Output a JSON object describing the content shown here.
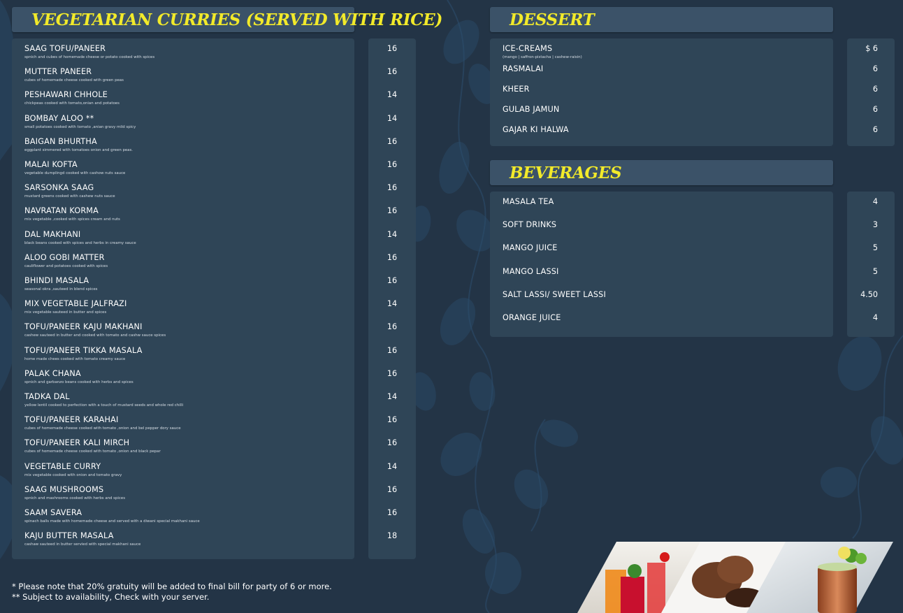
{
  "curries": {
    "title": "VEGETARIAN  CURRIES (SERVED WITH RICE)",
    "items": [
      {
        "name": "SAAG TOFU/PANEER",
        "desc": "spnich and cubes of homemade cheese or potato cooked with spices",
        "price": "16"
      },
      {
        "name": "MUTTER PANEER",
        "desc": "cubes of homemade cheese cooked with green peas",
        "price": "16"
      },
      {
        "name": "PESHAWARI CHHOLE",
        "desc": "chickpeas cooked with tomato,onian and potatoes",
        "price": "14"
      },
      {
        "name": "BOMBAY ALOO **",
        "desc": "small potatoes cooked with tomato ,anian gravy mild spicy",
        "price": "14"
      },
      {
        "name": "BAIGAN BHURTHA",
        "desc": "eggplant simmered with tomatoes  onion and green peas.",
        "price": "16"
      },
      {
        "name": "MALAI KOFTA",
        "desc": "vegetable dumplingd cooked with cashow nuts sauce",
        "price": "16"
      },
      {
        "name": "SARSONKA SAAG",
        "desc": "mustard greens cooked with cashew nuts sauce",
        "price": "16"
      },
      {
        "name": "NAVRATAN KORMA",
        "desc": "mix vegetable ,cooked with spices cream and nuts",
        "price": "16"
      },
      {
        "name": "DAL MAKHANI",
        "desc": "black beans cooked with spices and herbs in creamy sauce",
        "price": "14"
      },
      {
        "name": "ALOO GOBI MATTER",
        "desc": "cauliflower and potatoes cooked with spices",
        "price": "16"
      },
      {
        "name": "BHINDI MASALA",
        "desc": "seasonal okra ,sauteed in blend spices",
        "price": "16"
      },
      {
        "name": "MIX VEGETABLE JALFRAZI",
        "desc": "mix vegetable sauteed in butter and spices",
        "price": "14"
      },
      {
        "name": "TOFU/PANEER KAJU MAKHANI",
        "desc": "cashew sauteed in butter and cooked with tomato and cashw sauce spices",
        "price": "16"
      },
      {
        "name": "TOFU/PANEER TIKKA MASALA",
        "desc": "home made  chees cooked with tomato creamy sauce",
        "price": "16"
      },
      {
        "name": "PALAK CHANA",
        "desc": "spnich and garbanzo beans cooked with herbs and spices",
        "price": "16"
      },
      {
        "name": "TADKA DAL",
        "desc": "yellow lentil cooked to perfection with a touch of mustard seeds and whole red chilli",
        "price": "14"
      },
      {
        "name": "TOFU/PANEER KARAHAI",
        "desc": "cubes of homemade cheese cooked with tomato ,onion and bel pepper dory sauce",
        "price": "16"
      },
      {
        "name": "TOFU/PANEER KALI MIRCH",
        "desc": "cubes of homemade cheese cooked with tomato ,onion and black pepar",
        "price": "16"
      },
      {
        "name": "VEGETABLE CURRY",
        "desc": "mix vegetable cooked with onion and tomato gravy",
        "price": "14"
      },
      {
        "name": "SAAG MUSHROOMS",
        "desc": "spnich and mashrooms cooked with herbs and spices",
        "price": "16"
      },
      {
        "name": "SAAM SAVERA",
        "desc": "spinach balls made with homemade cheese and served with a diwani special makhani sauce",
        "price": "16"
      },
      {
        "name": "KAJU BUTTER MASALA",
        "desc": "cashaw sauteed in butter servied with  special makhani sauce",
        "price": "18"
      }
    ]
  },
  "dessert": {
    "title": "DESSERT",
    "items": [
      {
        "name": "ICE-CREAMS",
        "desc": "(mango  |  saffron-pistacha  |  cashew-raisin)",
        "price": "$ 6"
      },
      {
        "name": "RASMALAI",
        "desc": "",
        "price": "6"
      },
      {
        "name": "KHEER",
        "desc": "",
        "price": "6"
      },
      {
        "name": "GULAB JAMUN",
        "desc": "",
        "price": "6"
      },
      {
        "name": "GAJAR KI HALWA",
        "desc": "",
        "price": "6"
      }
    ]
  },
  "beverages": {
    "title": "BEVERAGES",
    "items": [
      {
        "name": "MASALA TEA",
        "price": "4"
      },
      {
        "name": "SOFT DRINKS",
        "price": "3"
      },
      {
        "name": "MANGO JUICE",
        "price": "5"
      },
      {
        "name": "MANGO LASSI",
        "price": "5"
      },
      {
        "name": "SALT LASSI/ SWEET LASSI",
        "price": "4.50"
      },
      {
        "name": "ORANGE JUICE",
        "price": "4"
      }
    ]
  },
  "footnotes": {
    "gratuity": "* Please note that 20% gratuity will be added to final bill for party of 6 or more.",
    "availability": "** Subject to availability, Check with your server."
  },
  "colors": {
    "background": "#233446",
    "panel": "#2f4557",
    "header": "#3b5268",
    "title_yellow": "#f2ea2a"
  }
}
